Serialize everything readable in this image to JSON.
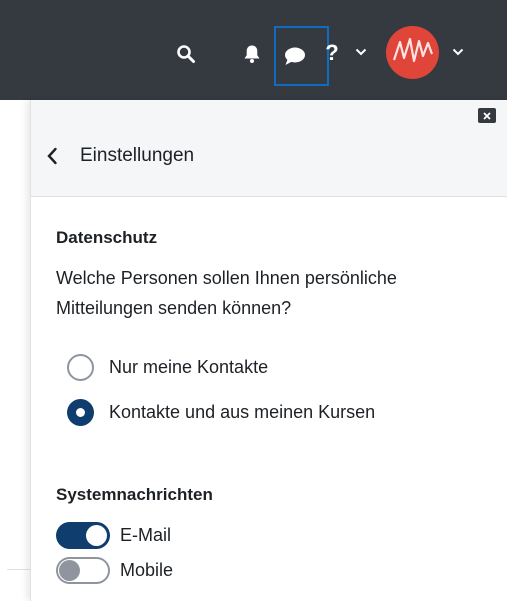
{
  "navbar": {
    "icons": {
      "search": "search-icon",
      "notifications": "bell-icon",
      "messages": "chat-bubble-icon",
      "help_chevron": "chevron-down-icon",
      "user_chevron": "chevron-down-icon"
    },
    "help_label": "?",
    "colors": {
      "background": "#343a40",
      "focus_outline": "#0f6cbf",
      "avatar": "#e0453a"
    }
  },
  "drawer": {
    "close_icon": "close-icon",
    "back_icon": "chevron-left-icon",
    "title": "Einstellungen",
    "privacy": {
      "title": "Datenschutz",
      "question": "Welche Personen sollen Ihnen persönliche Mitteilungen senden können?",
      "options": [
        {
          "label": "Nur meine Kontakte",
          "checked": false
        },
        {
          "label": "Kontakte und aus meinen Kursen",
          "checked": true
        }
      ]
    },
    "system": {
      "title": "Systemnachrichten",
      "toggles": [
        {
          "label": "E-Mail",
          "on": true
        },
        {
          "label": "Mobile",
          "on": false
        }
      ]
    },
    "colors": {
      "accent": "#0f3d6e",
      "header_bg": "#f5f6f7"
    }
  }
}
